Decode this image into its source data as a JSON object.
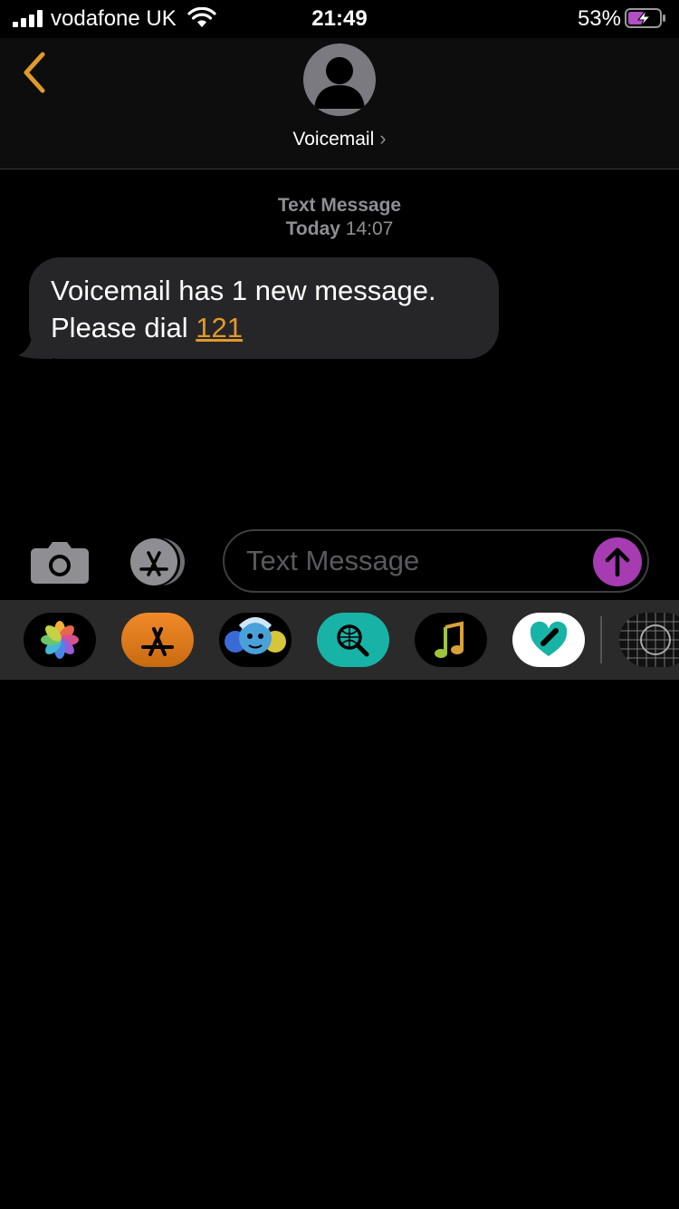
{
  "status_bar": {
    "carrier": "vodafone UK",
    "time": "21:49",
    "battery_percent": "53%",
    "battery_level": 0.53,
    "charging": true
  },
  "header": {
    "contact_name": "Voicemail",
    "chevron": "›",
    "back_icon": "chevron-left-icon"
  },
  "thread": {
    "service": "Text Message",
    "day": "Today",
    "time": "14:07",
    "message": {
      "line1": "Voicemail has 1 new message.",
      "line2_prefix": "Please dial ",
      "link": "121"
    }
  },
  "compose": {
    "placeholder": "Text Message"
  },
  "app_drawer": {
    "apps": [
      "photos-icon",
      "app-store-icon",
      "memoji-icon",
      "web-search-icon",
      "music-icon",
      "digital-touch-icon",
      "stickers-icon"
    ]
  },
  "colors": {
    "accent": "#e09a2a",
    "bubble": "#262628",
    "send": "#a63bb2",
    "drawer": "#2a2a2a"
  }
}
